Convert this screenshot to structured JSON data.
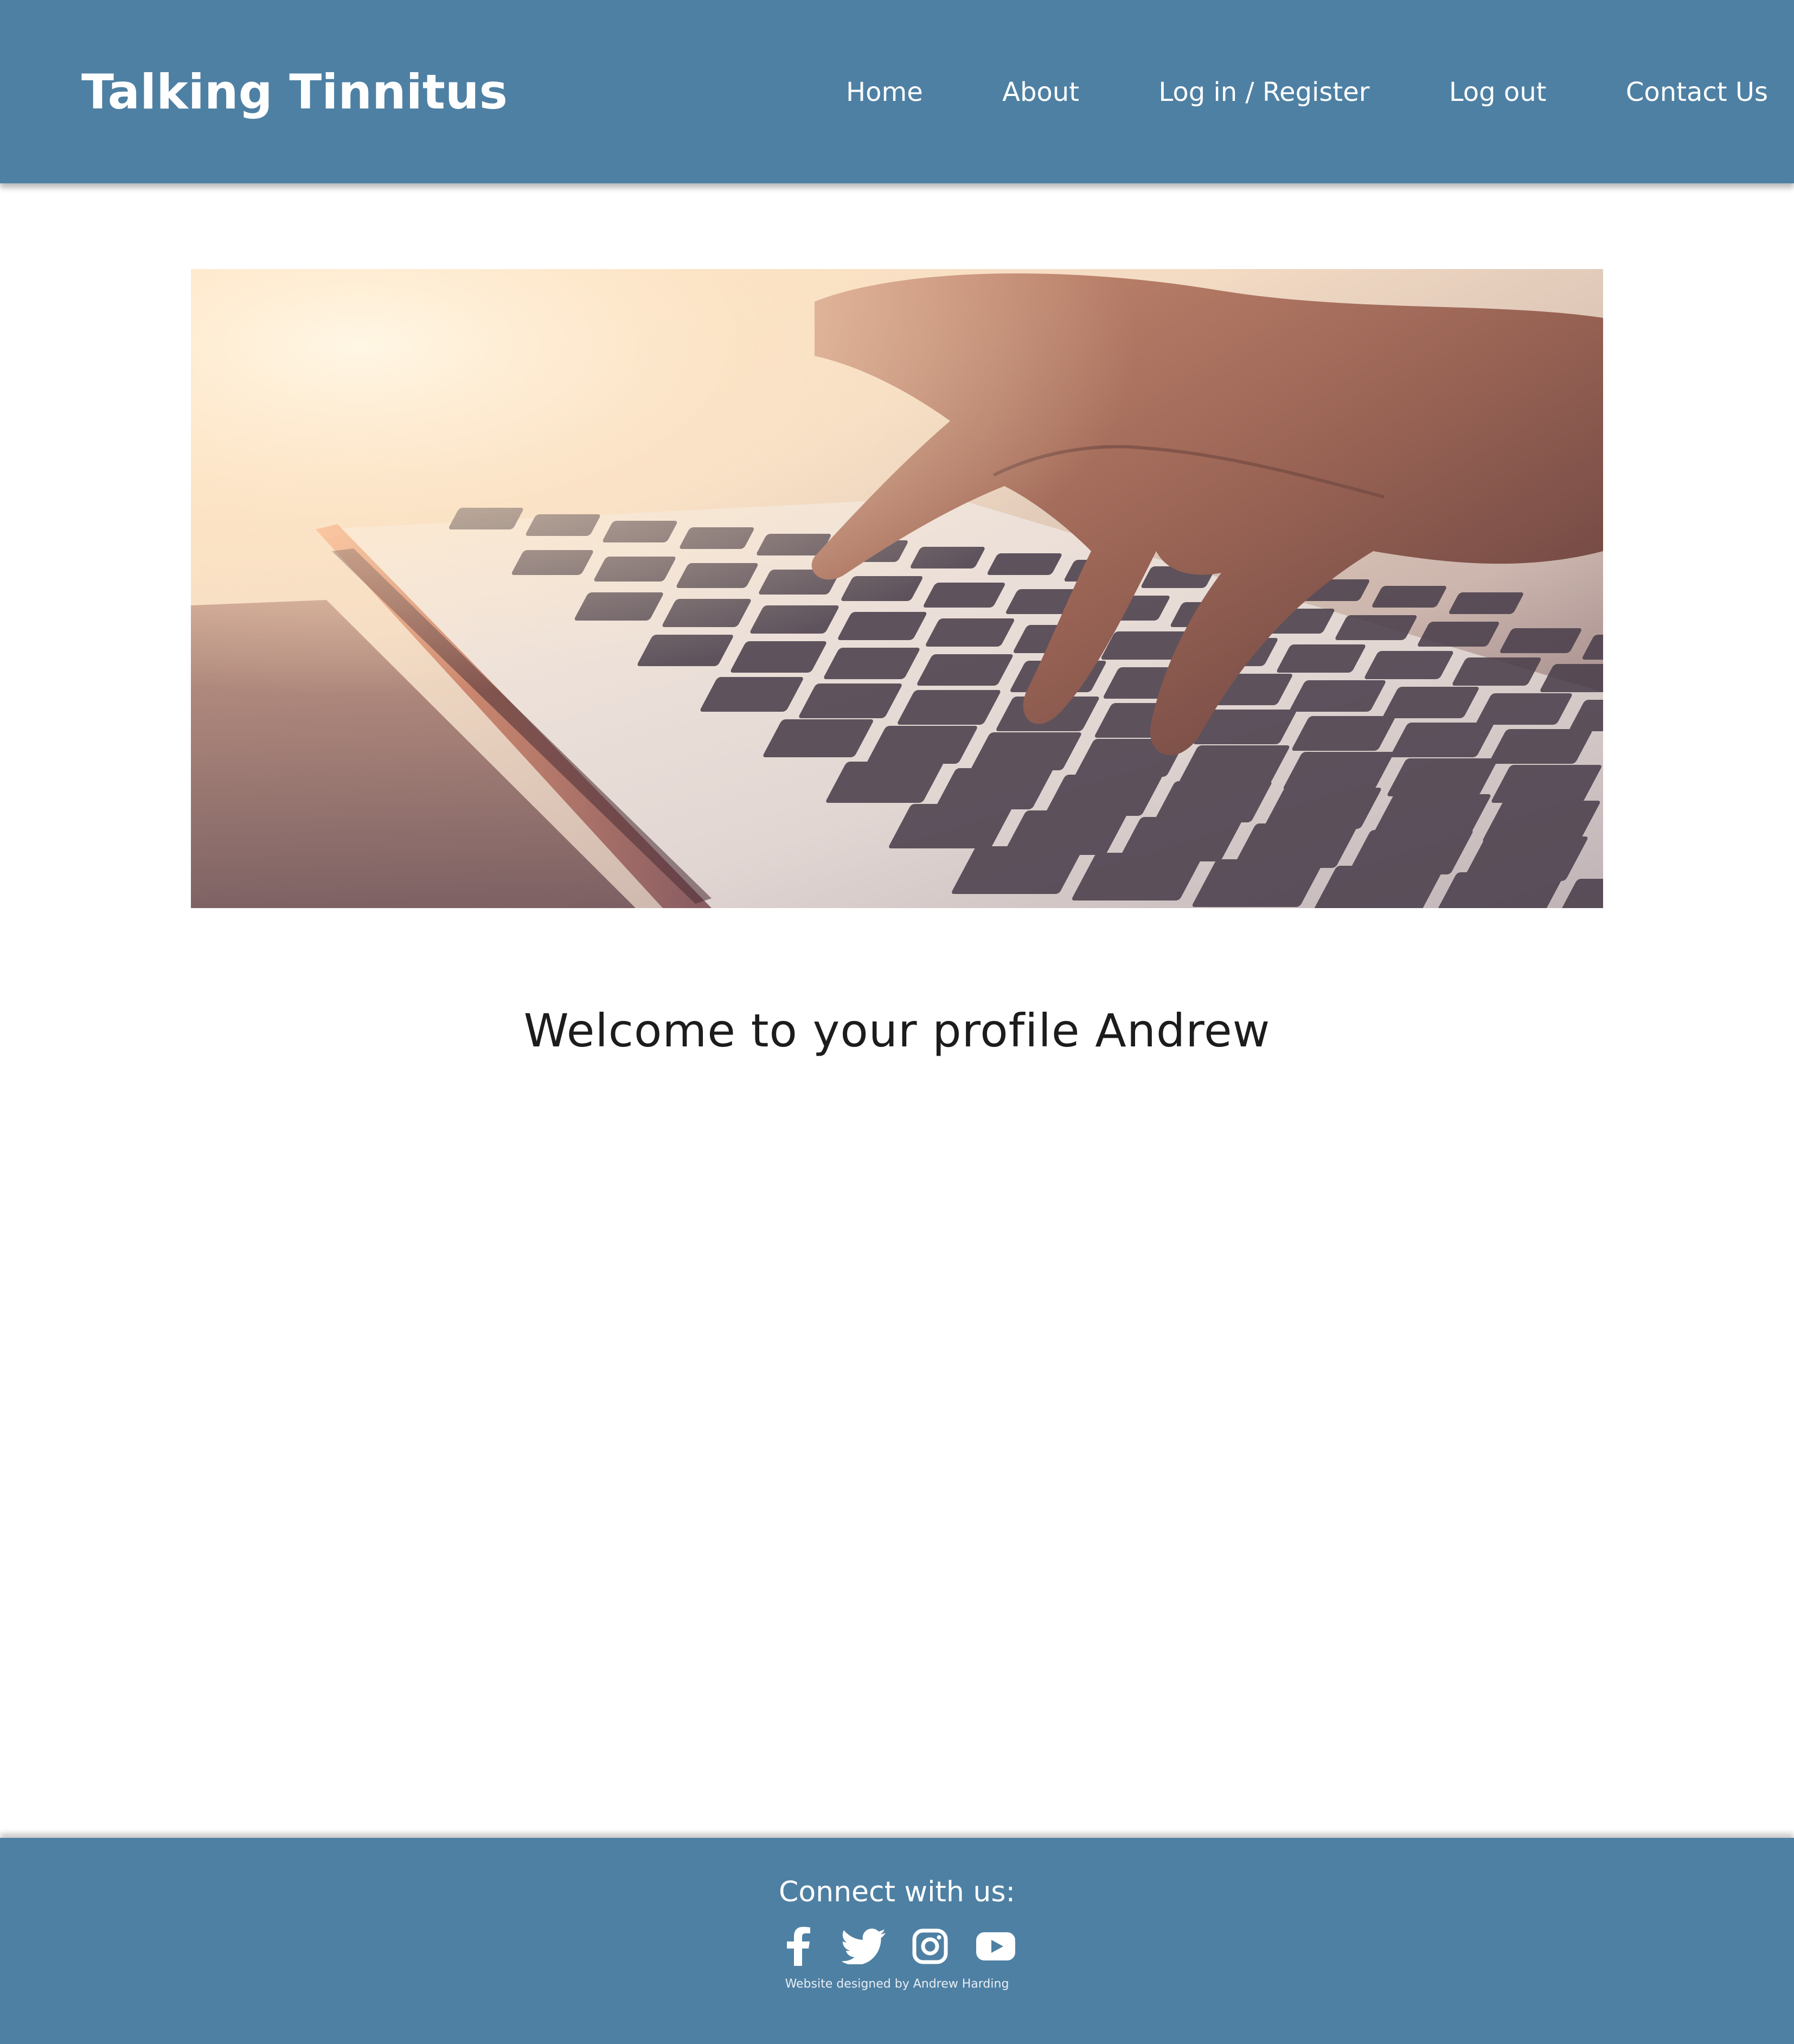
{
  "header": {
    "site_title": "Talking Tinnitus",
    "nav": [
      {
        "label": "Home"
      },
      {
        "label": "About"
      },
      {
        "label": "Log in / Register"
      },
      {
        "label": "Log out"
      },
      {
        "label": "Contact Us"
      }
    ]
  },
  "hero": {
    "image": "photo of hands typing on a laptop keyboard"
  },
  "main": {
    "welcome": "Welcome to your profile Andrew"
  },
  "footer": {
    "connect_label": "Connect with us:",
    "social": [
      {
        "icon": "facebook-icon"
      },
      {
        "icon": "twitter-icon"
      },
      {
        "icon": "instagram-icon"
      },
      {
        "icon": "youtube-icon"
      }
    ],
    "credit": "Website designed by Andrew Harding"
  },
  "colors": {
    "brand_blue": "#4e80a3",
    "text_dark": "#1c1c1c",
    "white": "#ffffff"
  }
}
